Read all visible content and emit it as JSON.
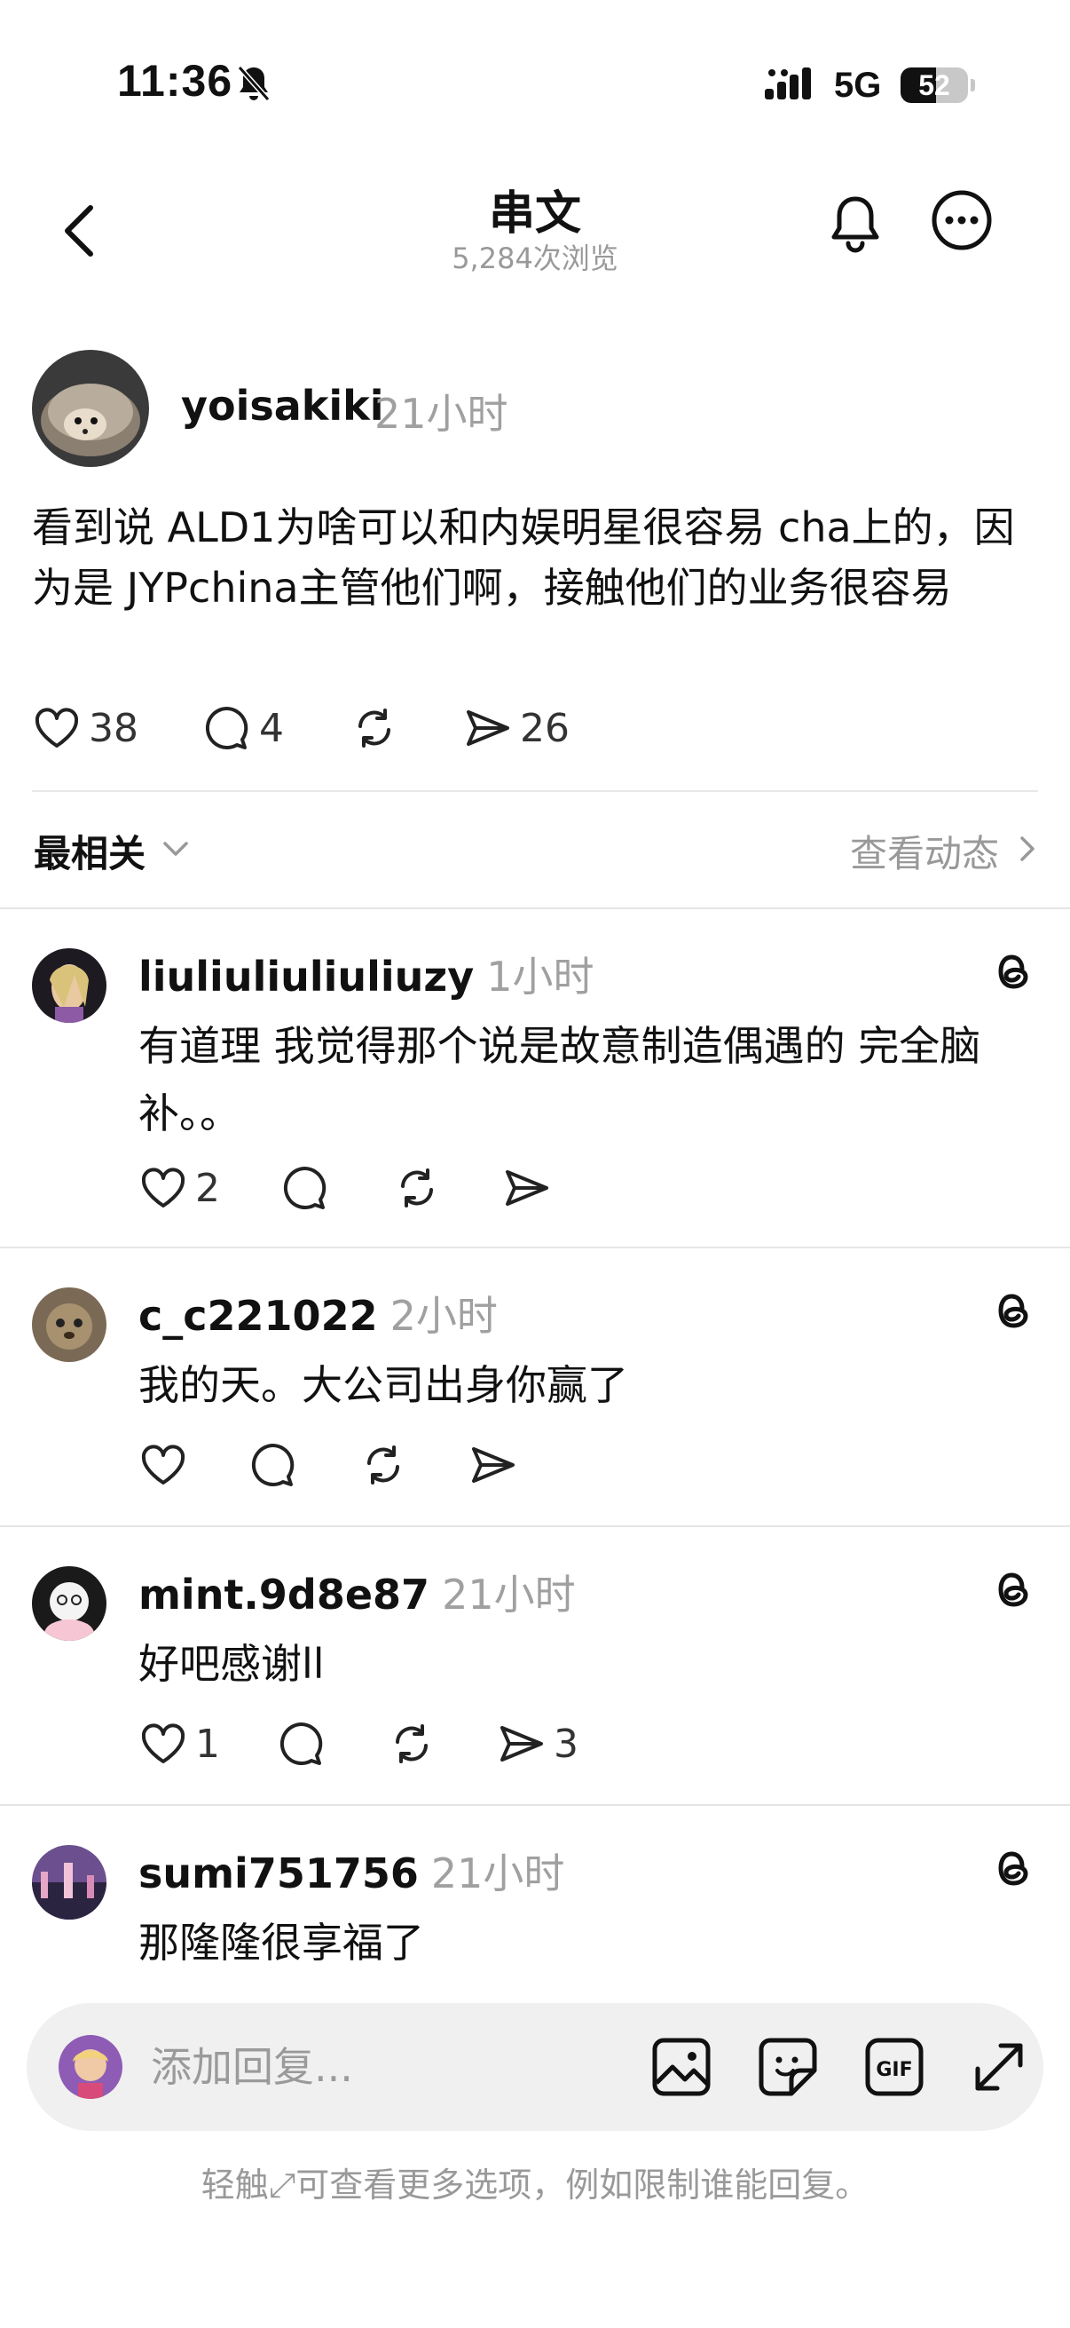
{
  "status_bar": {
    "time": "11:36",
    "network": "5G",
    "battery": "52",
    "battery_level": 0.52
  },
  "header": {
    "back_icon": "chevron-left-icon",
    "title": "串文",
    "views": "5,284次浏览",
    "bell_icon": "bell-icon",
    "more_icon": "more-icon"
  },
  "post": {
    "username": "yoisakiki",
    "time": "21小时",
    "text": "看到说 ALD1为啥可以和内娱明星很容易 cha上的，因为是 JYPchina主管他们啊，接触他们的业务很容易",
    "likes": "38",
    "comments": "4",
    "shares": "26"
  },
  "sort": {
    "label": "最相关",
    "activity": "查看动态"
  },
  "replies": [
    {
      "username": "liuliuliuliuliuzy",
      "time": "1小时",
      "text": "有道理 我觉得那个说是故意制造偶遇的 完全脑补。。",
      "likes": "2",
      "shares": ""
    },
    {
      "username": "c_c221022",
      "time": "2小时",
      "text": "我的天。大公司出身你赢了",
      "likes": "",
      "shares": ""
    },
    {
      "username": "mint.9d8e87",
      "time": "21小时",
      "text": "好吧感谢ll",
      "likes": "1",
      "shares": "3"
    },
    {
      "username": "sumi751756",
      "time": "21小时",
      "text": "那隆隆很享福了",
      "likes": "",
      "shares": ""
    }
  ],
  "composer": {
    "placeholder": "添加回复...",
    "icons": [
      "image-icon",
      "sticker-icon",
      "gif-icon",
      "expand-icon"
    ]
  },
  "hint": "轻触⤢可查看更多选项，例如限制谁能回复。",
  "colors": {
    "text": "#111111",
    "muted": "#999999",
    "divider": "#e5e5e5",
    "composer_bg": "#f0f0f0"
  }
}
